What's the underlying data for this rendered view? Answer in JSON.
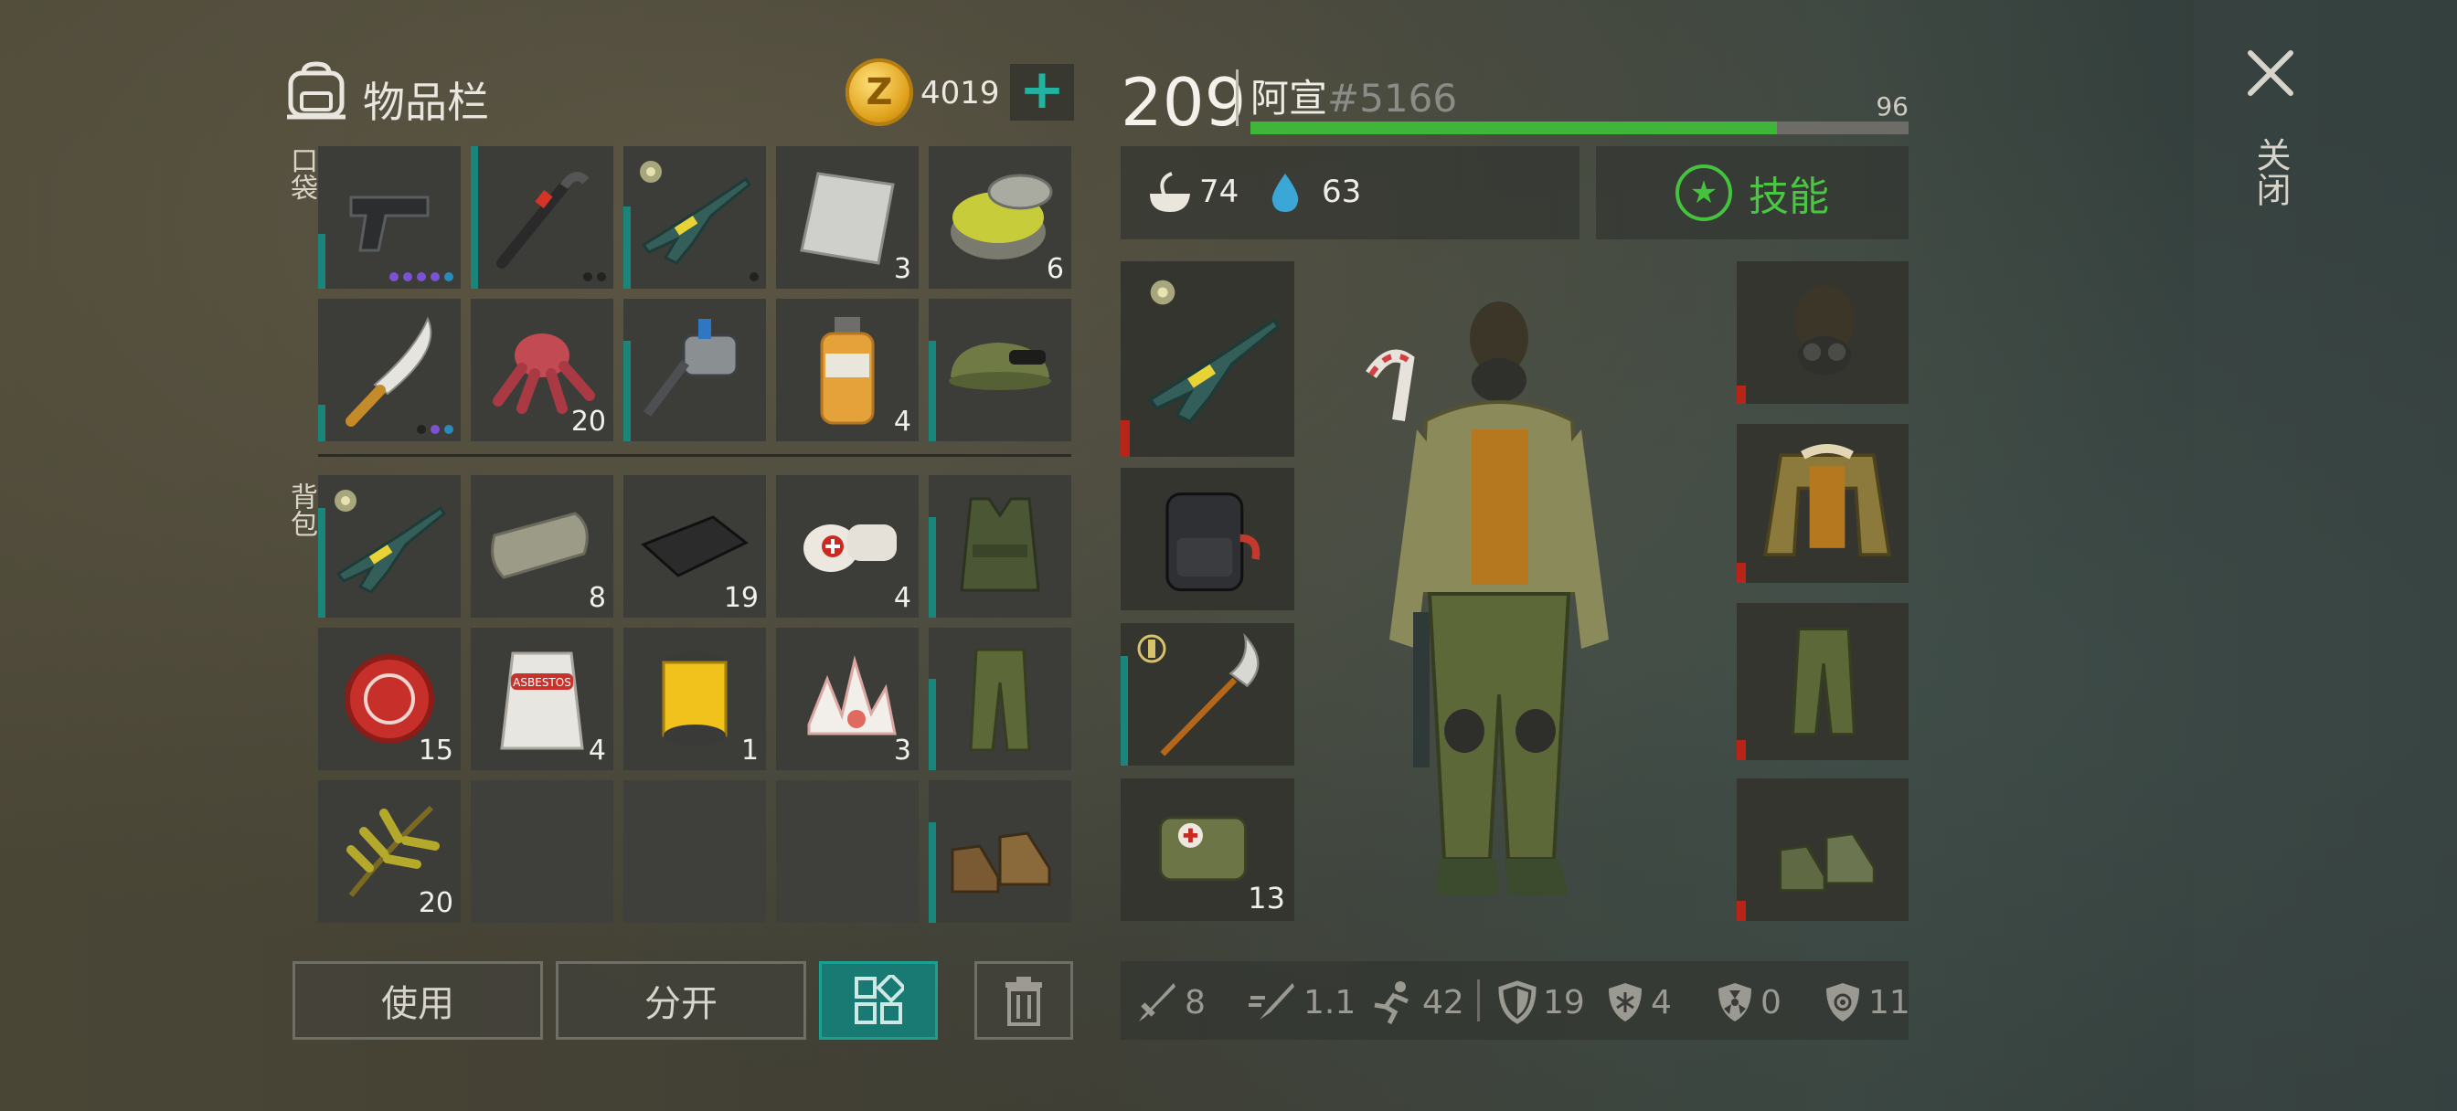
{
  "inventory": {
    "title": "物品栏",
    "coins": "4019",
    "coin_symbol": "Z",
    "pockets_label": "口袋",
    "backpack_label": "背包",
    "pocket_items": [
      {
        "name": "pistol",
        "qty": "",
        "dots": "purple4"
      },
      {
        "name": "crowbar",
        "qty": "",
        "dots": "dark2"
      },
      {
        "name": "rifle",
        "qty": "",
        "dots": "dark1"
      },
      {
        "name": "metal-sheet",
        "qty": "3"
      },
      {
        "name": "jar",
        "qty": "6"
      },
      {
        "name": "machete",
        "qty": "",
        "dots": "mix"
      },
      {
        "name": "flesh",
        "qty": "20"
      },
      {
        "name": "drill",
        "qty": ""
      },
      {
        "name": "bottle",
        "qty": "4"
      },
      {
        "name": "cap",
        "qty": ""
      }
    ],
    "backpack_items": [
      {
        "name": "rifle",
        "qty": ""
      },
      {
        "name": "roll",
        "qty": "8"
      },
      {
        "name": "cloth",
        "qty": "19"
      },
      {
        "name": "bandage",
        "qty": "4"
      },
      {
        "name": "vest",
        "qty": ""
      },
      {
        "name": "bottle-cap",
        "qty": "15"
      },
      {
        "name": "asbestos-bag",
        "qty": "4"
      },
      {
        "name": "filter",
        "qty": "1"
      },
      {
        "name": "crystal",
        "qty": "3"
      },
      {
        "name": "pants",
        "qty": ""
      },
      {
        "name": "herb",
        "qty": "20"
      },
      {
        "name": "empty",
        "qty": ""
      },
      {
        "name": "empty",
        "qty": ""
      },
      {
        "name": "empty",
        "qty": ""
      },
      {
        "name": "boots",
        "qty": ""
      }
    ],
    "bag_print": "ASBESTOS",
    "buttons": {
      "use": "使用",
      "split": "分开"
    }
  },
  "character": {
    "level": "209",
    "name": "阿宣",
    "tag": "#5166",
    "xp_value": "96",
    "xp_fraction": 0.8,
    "hunger": "74",
    "thirst": "63",
    "skills_label": "技能",
    "medkit_qty": "13"
  },
  "combat_stats": {
    "damage": "8",
    "speed": "1.1",
    "move": "42",
    "armor": "19",
    "cold": "4",
    "radiation": "0",
    "infection": "11"
  },
  "close_label": "关闭",
  "colors": {
    "accent_teal": "#1a9f93",
    "xp_green": "#3fb63a",
    "skill_green": "#45c23e",
    "durability_red": "#b82418"
  }
}
